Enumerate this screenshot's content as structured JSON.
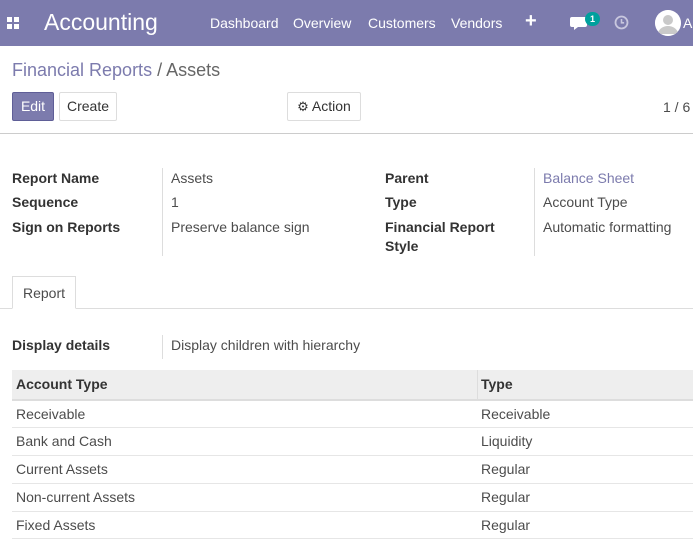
{
  "topbar": {
    "app_title": "Accounting",
    "menu": [
      "Dashboard",
      "Overview",
      "Customers",
      "Vendors"
    ],
    "chat_badge": "1",
    "user_initial": "A"
  },
  "breadcrumb": {
    "parent": "Financial Reports",
    "separator": "/",
    "current": "Assets"
  },
  "toolbar": {
    "edit": "Edit",
    "create": "Create",
    "action": "Action",
    "pager": "1 / 6"
  },
  "form": {
    "report_name_label": "Report Name",
    "report_name": "Assets",
    "sequence_label": "Sequence",
    "sequence": "1",
    "sign_label": "Sign on Reports",
    "sign": "Preserve balance sign",
    "parent_label": "Parent",
    "parent": "Balance Sheet",
    "type_label": "Type",
    "type": "Account Type",
    "style_label_1": "Financial Report",
    "style_label_2": "Style",
    "style": "Automatic formatting"
  },
  "tabs": [
    "Report"
  ],
  "report": {
    "display_label": "Display details",
    "display": "Display children with hierarchy",
    "columns": [
      "Account Type",
      "Type"
    ],
    "rows": [
      [
        "Receivable",
        "Receivable"
      ],
      [
        "Bank and Cash",
        "Liquidity"
      ],
      [
        "Current Assets",
        "Regular"
      ],
      [
        "Non-current Assets",
        "Regular"
      ],
      [
        "Fixed Assets",
        "Regular"
      ]
    ]
  },
  "colors": {
    "brand": "#7c7bad",
    "badge": "#00a09d"
  }
}
